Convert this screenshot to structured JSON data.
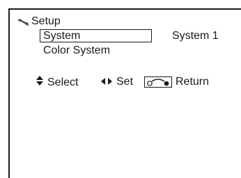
{
  "header": {
    "title": "Setup",
    "icon": "wrench-icon"
  },
  "menu": {
    "items": [
      {
        "label": "System",
        "selected": true
      },
      {
        "label": "Color System",
        "selected": false
      }
    ],
    "selected_value": "System 1"
  },
  "help": {
    "select_label": "Select",
    "set_label": "Set",
    "return_label": "Return"
  }
}
